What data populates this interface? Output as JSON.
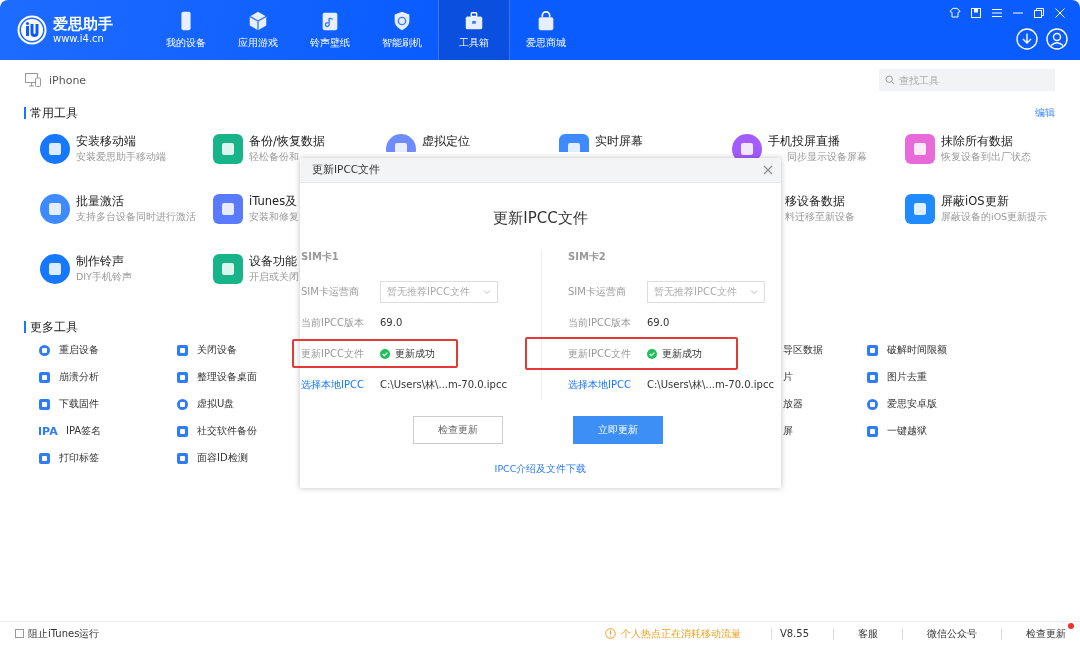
{
  "brand": {
    "name": "爱思助手",
    "url": "www.i4.cn"
  },
  "nav": [
    {
      "label": "我的设备",
      "selected": false
    },
    {
      "label": "应用游戏",
      "selected": false
    },
    {
      "label": "铃声壁纸",
      "selected": false
    },
    {
      "label": "智能刷机",
      "selected": false
    },
    {
      "label": "工具箱",
      "selected": true
    },
    {
      "label": "爱思商城",
      "selected": false
    }
  ],
  "device": {
    "name": "iPhone"
  },
  "search": {
    "placeholder": "查找工具"
  },
  "common_tools": {
    "title": "常用工具",
    "edit": "编辑",
    "rows": [
      {
        "left": [
          {
            "kind": "tool",
            "title": "安装移动端",
            "subtitle": "安装爱思助手移动端"
          },
          {
            "kind": "tool",
            "title": "备份/恢复数据",
            "subtitle": "轻松备份和"
          },
          {
            "kind": "tool",
            "title": "虚拟定位"
          },
          {
            "kind": "tool",
            "title": "实时屏幕"
          },
          {
            "kind": "subcut",
            "title": "手机投屏直播",
            "subtitle": "同步显示设备屏幕"
          },
          {
            "kind": "tool",
            "title": "抹除所有数据",
            "subtitle": "恢复设备到出厂状态"
          }
        ]
      },
      {
        "left": [
          {
            "kind": "tool",
            "title": "批量激活",
            "subtitle": "支持多台设备同时进行激活"
          },
          {
            "kind": "tool",
            "title": "iTunes及",
            "subtitle": "安装和修复"
          }
        ],
        "right": [
          {
            "kind": "cut",
            "title": "移设备数据",
            "subtitle": "料迁移至新设备"
          },
          {
            "kind": "tool",
            "title": "屏蔽iOS更新",
            "subtitle": "屏蔽设备的iOS更新提示"
          }
        ]
      },
      {
        "left": [
          {
            "kind": "tool",
            "title": "制作铃声",
            "subtitle": "DIY手机铃声"
          },
          {
            "kind": "tool",
            "title": "设备功能",
            "subtitle": "开启或关闭"
          }
        ]
      }
    ]
  },
  "more_tools": {
    "title": "更多工具",
    "rows": [
      {
        "left": [
          {
            "kind": "tool",
            "label": "重启设备"
          },
          {
            "kind": "tool",
            "label": "关闭设备"
          }
        ],
        "right": [
          {
            "kind": "cut",
            "label": "导区数据"
          },
          {
            "kind": "tool",
            "label": "破解时间限额"
          }
        ]
      },
      {
        "left": [
          {
            "kind": "tool",
            "label": "崩溃分析"
          },
          {
            "kind": "tool",
            "label": "整理设备桌面"
          }
        ],
        "right": [
          {
            "kind": "cut",
            "label": "片"
          },
          {
            "kind": "tool",
            "label": "图片去重"
          }
        ]
      },
      {
        "left": [
          {
            "kind": "tool",
            "label": "下载固件"
          },
          {
            "kind": "tool",
            "label": "虚拟U盘"
          }
        ],
        "right": [
          {
            "kind": "cut",
            "label": "放器"
          },
          {
            "kind": "tool",
            "label": "爱思安卓版"
          }
        ]
      },
      {
        "left": [
          {
            "kind": "text",
            "icon_text": "IPA",
            "label": "IPA签名"
          },
          {
            "kind": "tool",
            "label": "社交软件备份"
          }
        ],
        "right": [
          {
            "kind": "cut",
            "label": "屏"
          },
          {
            "kind": "tool",
            "label": "一键越狱"
          }
        ]
      },
      {
        "left": [
          {
            "kind": "tool",
            "label": "打印标签"
          },
          {
            "kind": "tool",
            "label": "面容ID检测"
          }
        ]
      }
    ]
  },
  "dialog": {
    "window_title": "更新IPCC文件",
    "heading": "更新IPCC文件",
    "sims": [
      {
        "title": "SIM卡1",
        "carrier_label": "SIM卡运营商",
        "carrier_placeholder": "暂无推荐IPCC文件",
        "version_label": "当前IPCC版本",
        "version": "69.0",
        "file_label": "更新IPCC文件",
        "status": "更新成功",
        "highlighted": true,
        "choose_link": "选择本地IPCC",
        "path": "C:\\Users\\林\\...m-70.0.ipcc"
      },
      {
        "title": "SIM卡2",
        "carrier_label": "SIM卡运营商",
        "carrier_placeholder": "暂无推荐IPCC文件",
        "version_label": "当前IPCC版本",
        "version": "69.0",
        "file_label": "更新IPCC文件",
        "status": "更新成功",
        "highlighted": true,
        "choose_link": "选择本地IPCC",
        "path": "C:\\Users\\林\\...m-70.0.ipcc"
      }
    ],
    "buttons": [
      {
        "label": "检查更新",
        "kind": "secondary"
      },
      {
        "label": "立即更新",
        "kind": "primary"
      }
    ],
    "link": "IPCC介绍及文件下载"
  },
  "status_bar": {
    "block_itunes": {
      "label": "阻止iTunes运行",
      "checked": false
    },
    "warning": "个人热点正在消耗移动流量",
    "version": "V8.55",
    "items": [
      {
        "label": "客服",
        "badge": false
      },
      {
        "label": "微信公众号",
        "badge": false
      },
      {
        "label": "检查更新",
        "badge": true
      }
    ]
  }
}
